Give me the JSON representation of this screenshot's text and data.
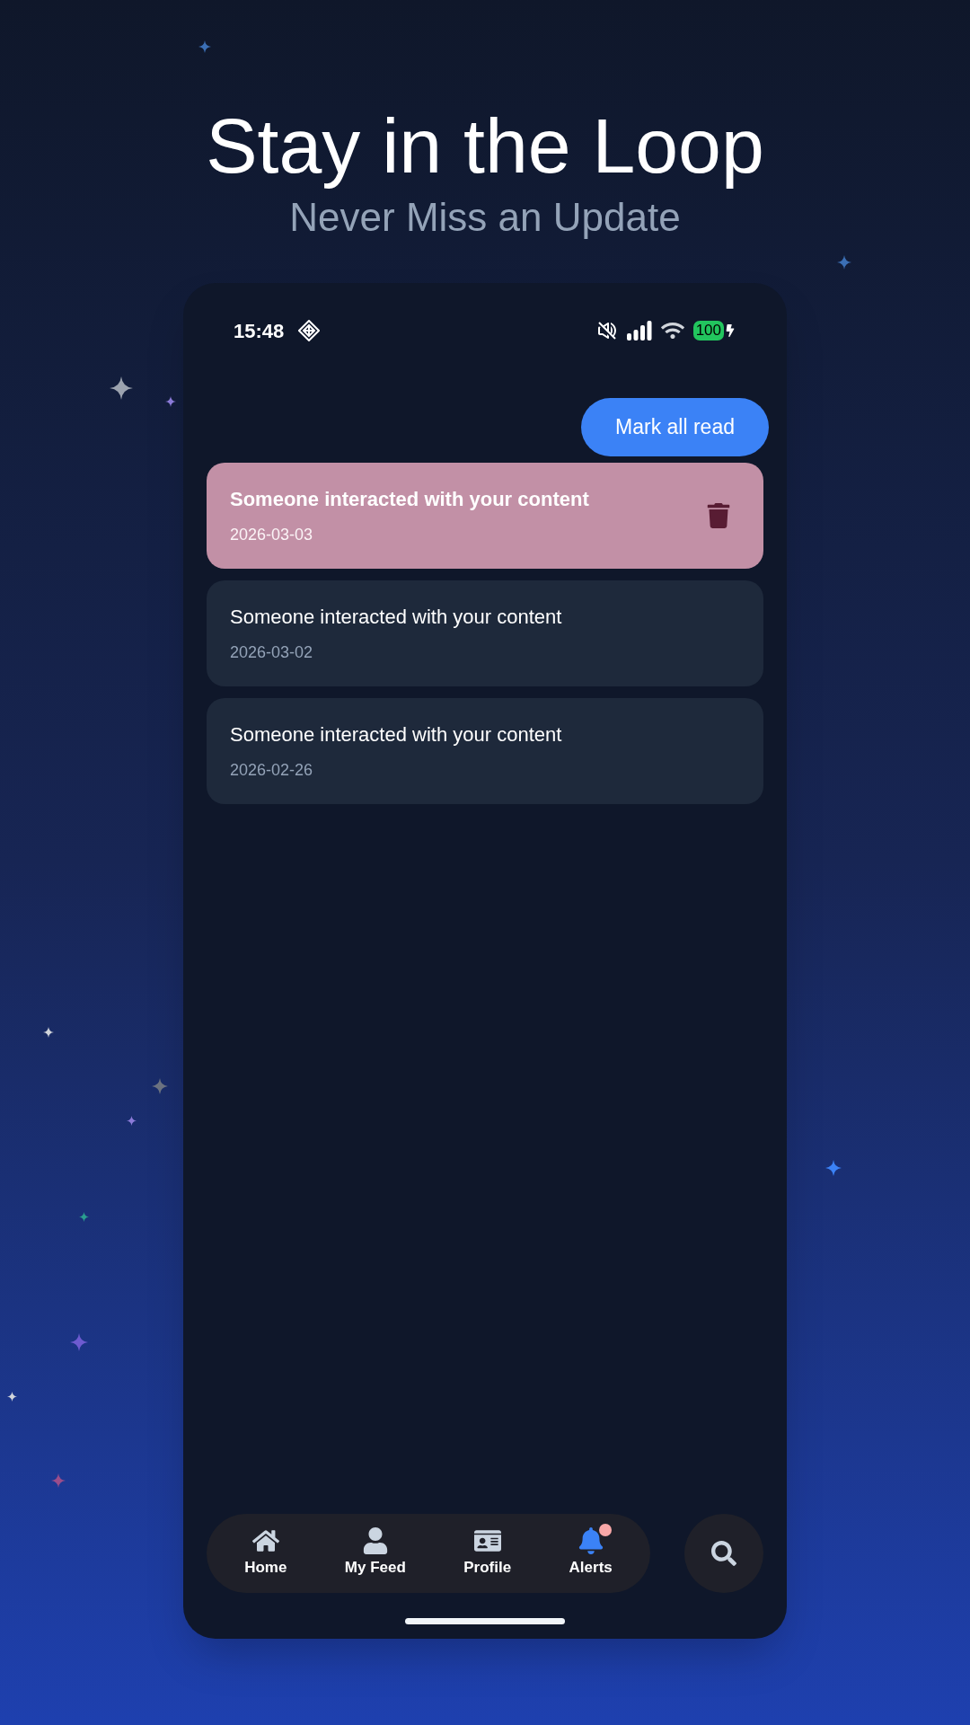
{
  "header": {
    "title": "Stay in the Loop",
    "subtitle": "Never Miss an Update"
  },
  "status_bar": {
    "time": "15:48",
    "battery": "100"
  },
  "mark_all_button": "Mark all read",
  "notifications": [
    {
      "title": "Someone interacted with your content",
      "date": "2026-03-03",
      "kind": "swiped"
    },
    {
      "title": "Someone interacted with your content",
      "date": "2026-03-02",
      "kind": "normal"
    },
    {
      "title": "Someone interacted with your content",
      "date": "2026-02-26",
      "kind": "normal"
    }
  ],
  "nav": [
    {
      "label": "Home",
      "kind": "home",
      "selected": false,
      "badge": false
    },
    {
      "label": "My Feed",
      "kind": "user",
      "selected": false,
      "badge": false
    },
    {
      "label": "Profile",
      "kind": "card",
      "selected": false,
      "badge": false
    },
    {
      "label": "Alerts",
      "kind": "bell",
      "selected": true,
      "badge": true
    }
  ]
}
